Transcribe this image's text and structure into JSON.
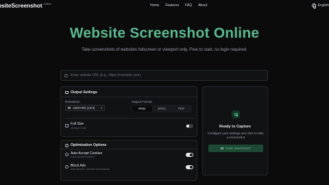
{
  "nav": {
    "brand": "bsiteScreenshot",
    "brand_badge": "Online",
    "links": [
      "Home",
      "Features",
      "FAQ",
      "About"
    ],
    "language": "English"
  },
  "hero": {
    "title": "Website Screenshot Online",
    "subtitle": "Take screenshots of websites fullscreen or viewport only. Free to start, no login required."
  },
  "url_input": {
    "placeholder": "Enter website URL (e.g., https://example.com)",
    "value": ""
  },
  "output_settings": {
    "title": "Output Settings",
    "resolution_label": "Resolution",
    "resolution_value": "1600×900 (16:9)",
    "format_label": "Output Format",
    "formats": [
      "PNG",
      "JPEG",
      "PDF"
    ],
    "selected_format": "PNG",
    "full_size": {
      "label": "Full Size",
      "sub": "Viewport only",
      "enabled": false
    }
  },
  "optimization": {
    "title": "Optimization Options",
    "cookies": {
      "label": "Auto Accept Cookies",
      "sub": "Auto accept enabled",
      "enabled": true
    },
    "block_ads": {
      "label": "Block Ads",
      "sub": "Ads blocked, cleaner screenshots",
      "enabled": true
    }
  },
  "capture": {
    "title": "Ready to Capture",
    "desc": "Configure your settings and click to take a screenshot",
    "button": "TAKE SNAPSHOT"
  },
  "colors": {
    "accent": "#5cb88e",
    "background": "#0b0b0c",
    "card": "#111214"
  }
}
